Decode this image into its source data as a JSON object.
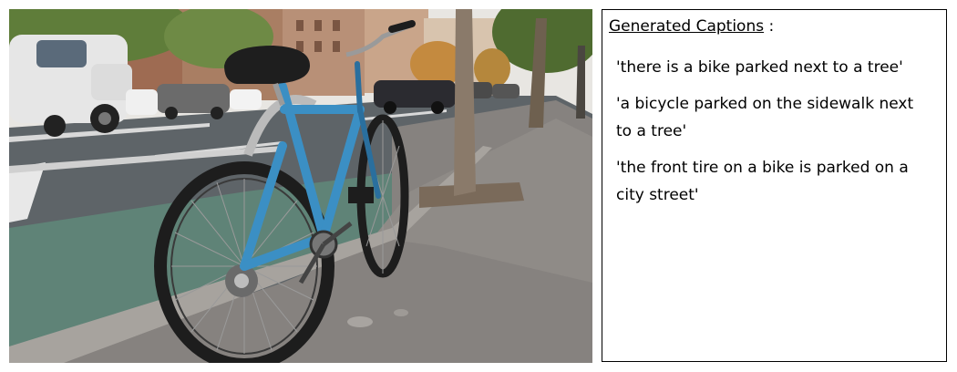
{
  "panel": {
    "heading": "Generated Captions",
    "heading_suffix": " :"
  },
  "captions": [
    "'there is a bike parked next to a tree'",
    "'a bicycle parked on the sidewalk next to a tree'",
    "'the front tire on a bike is parked on a city street'"
  ],
  "colors": {
    "bike_frame": "#3b8fc4",
    "bike_frame_dark": "#2a6f9e",
    "street": "#5e6468",
    "bike_lane": "#5f8377",
    "sidewalk": "#86827f",
    "sky": "#e8e6e2",
    "buildings": "#a97e63",
    "foliage": "#5f7d3a"
  },
  "icons": [
    "bicycle",
    "tree",
    "van",
    "car"
  ]
}
